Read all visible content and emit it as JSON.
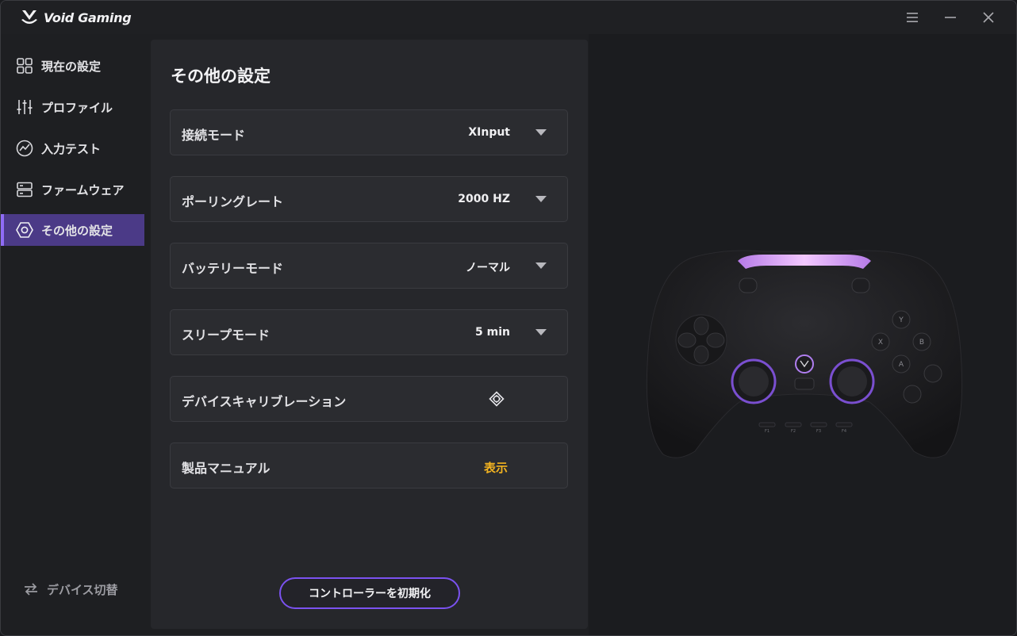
{
  "app": {
    "brand_name": "Void Gaming"
  },
  "window_controls": {
    "menu_icon": "menu-icon",
    "minimize_icon": "minimize-icon",
    "close_icon": "close-icon"
  },
  "sidebar": {
    "items": [
      {
        "label": "現在の設定",
        "icon": "grid-icon"
      },
      {
        "label": "プロファイル",
        "icon": "sliders-icon"
      },
      {
        "label": "入力テスト",
        "icon": "activity-icon"
      },
      {
        "label": "ファームウェア",
        "icon": "server-icon"
      },
      {
        "label": "その他の設定",
        "icon": "hexagon-settings-icon",
        "active": true
      }
    ],
    "switch_device_label": "デバイス切替"
  },
  "panel": {
    "title": "その他の設定",
    "rows": [
      {
        "label": "接続モード",
        "value": "XInput"
      },
      {
        "label": "ポーリングレート",
        "value": "2000 HZ"
      },
      {
        "label": "バッテリーモード",
        "value": "ノーマル"
      },
      {
        "label": "スリープモード",
        "value": "5 min"
      },
      {
        "label": "デバイスキャリブレーション",
        "icon": "calibration-icon"
      },
      {
        "label": "製品マニュアル",
        "link": "表示"
      }
    ],
    "reset_button_label": "コントローラーを初期化"
  },
  "colors": {
    "accent": "#7b52f0",
    "active_nav": "#4b3a87",
    "link": "#f2b320",
    "light_bar": "#e8a8ff"
  },
  "controller": {
    "face_buttons": [
      "Y",
      "X",
      "B",
      "A"
    ],
    "back_labels": [
      "F1",
      "F2",
      "F3",
      "F4"
    ]
  }
}
